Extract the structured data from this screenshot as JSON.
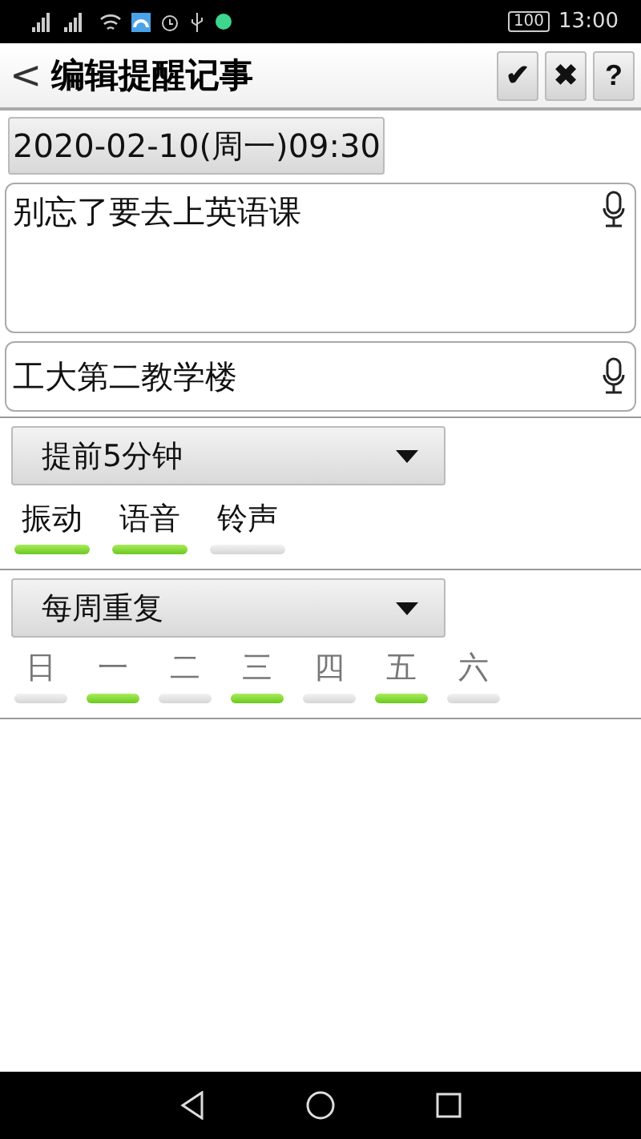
{
  "status_bar": {
    "battery": "100",
    "time": "13:00"
  },
  "header": {
    "back": "<",
    "title": "编辑提醒记事",
    "actions": [
      "✔",
      "✖",
      "?"
    ]
  },
  "datetime": "2020-02-10(周一)09:30",
  "memo": {
    "value": "别忘了要去上英语课"
  },
  "location": {
    "value": "工大第二教学楼"
  },
  "advance": {
    "value": "提前5分钟"
  },
  "alerts": [
    {
      "label": "振动",
      "on": true
    },
    {
      "label": "语音",
      "on": true
    },
    {
      "label": "铃声",
      "on": false
    }
  ],
  "repeat": {
    "value": "每周重复"
  },
  "weekdays": [
    {
      "label": "日",
      "on": false
    },
    {
      "label": "一",
      "on": true
    },
    {
      "label": "二",
      "on": false
    },
    {
      "label": "三",
      "on": true
    },
    {
      "label": "四",
      "on": false
    },
    {
      "label": "五",
      "on": true
    },
    {
      "label": "六",
      "on": false
    }
  ]
}
